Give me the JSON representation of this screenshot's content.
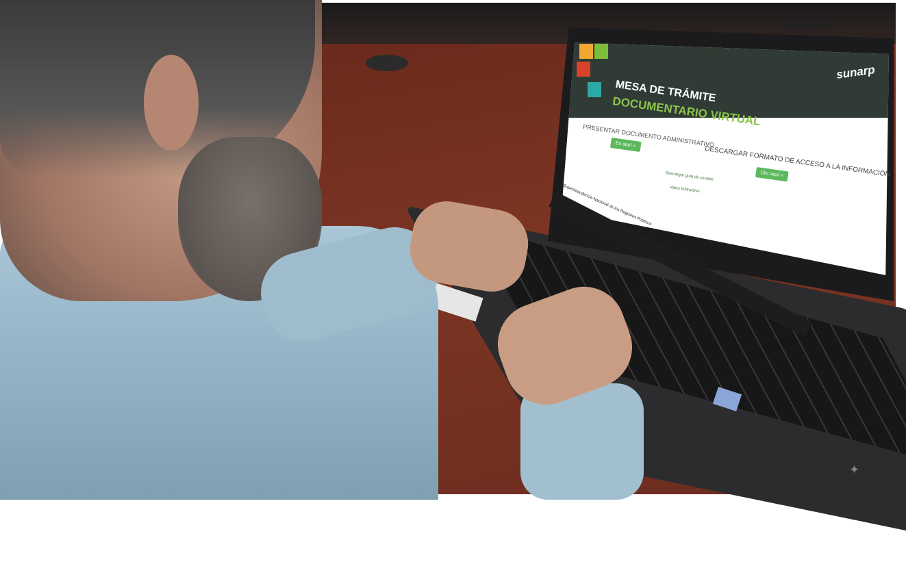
{
  "screen": {
    "title_line1": "MESA DE TRÁMITE",
    "title_line2": "DOCUMENTARIO VIRTUAL",
    "brand": "sunarp",
    "left_section_label": "PRESENTAR DOCUMENTO ADMINISTRATIVO",
    "left_button_label": "Es aquí »",
    "right_section_label": "DESCARGAR FORMATO DE ACCESO A LA INFORMACIÓN",
    "right_button_label": "Clic aquí »",
    "link_guide": "Descargar guía de usuario",
    "link_video": "Video Instructivo",
    "footer_text": "© Superintendencia Nacional de los Registros Públicos"
  },
  "colors": {
    "header_bg": "#2f3b34",
    "accent_green": "#8bc34a",
    "button_green": "#5cb85c",
    "square_orange": "#f0a830",
    "square_green": "#7cbd3c",
    "square_red": "#d9412b",
    "square_teal": "#2aa9a6"
  }
}
